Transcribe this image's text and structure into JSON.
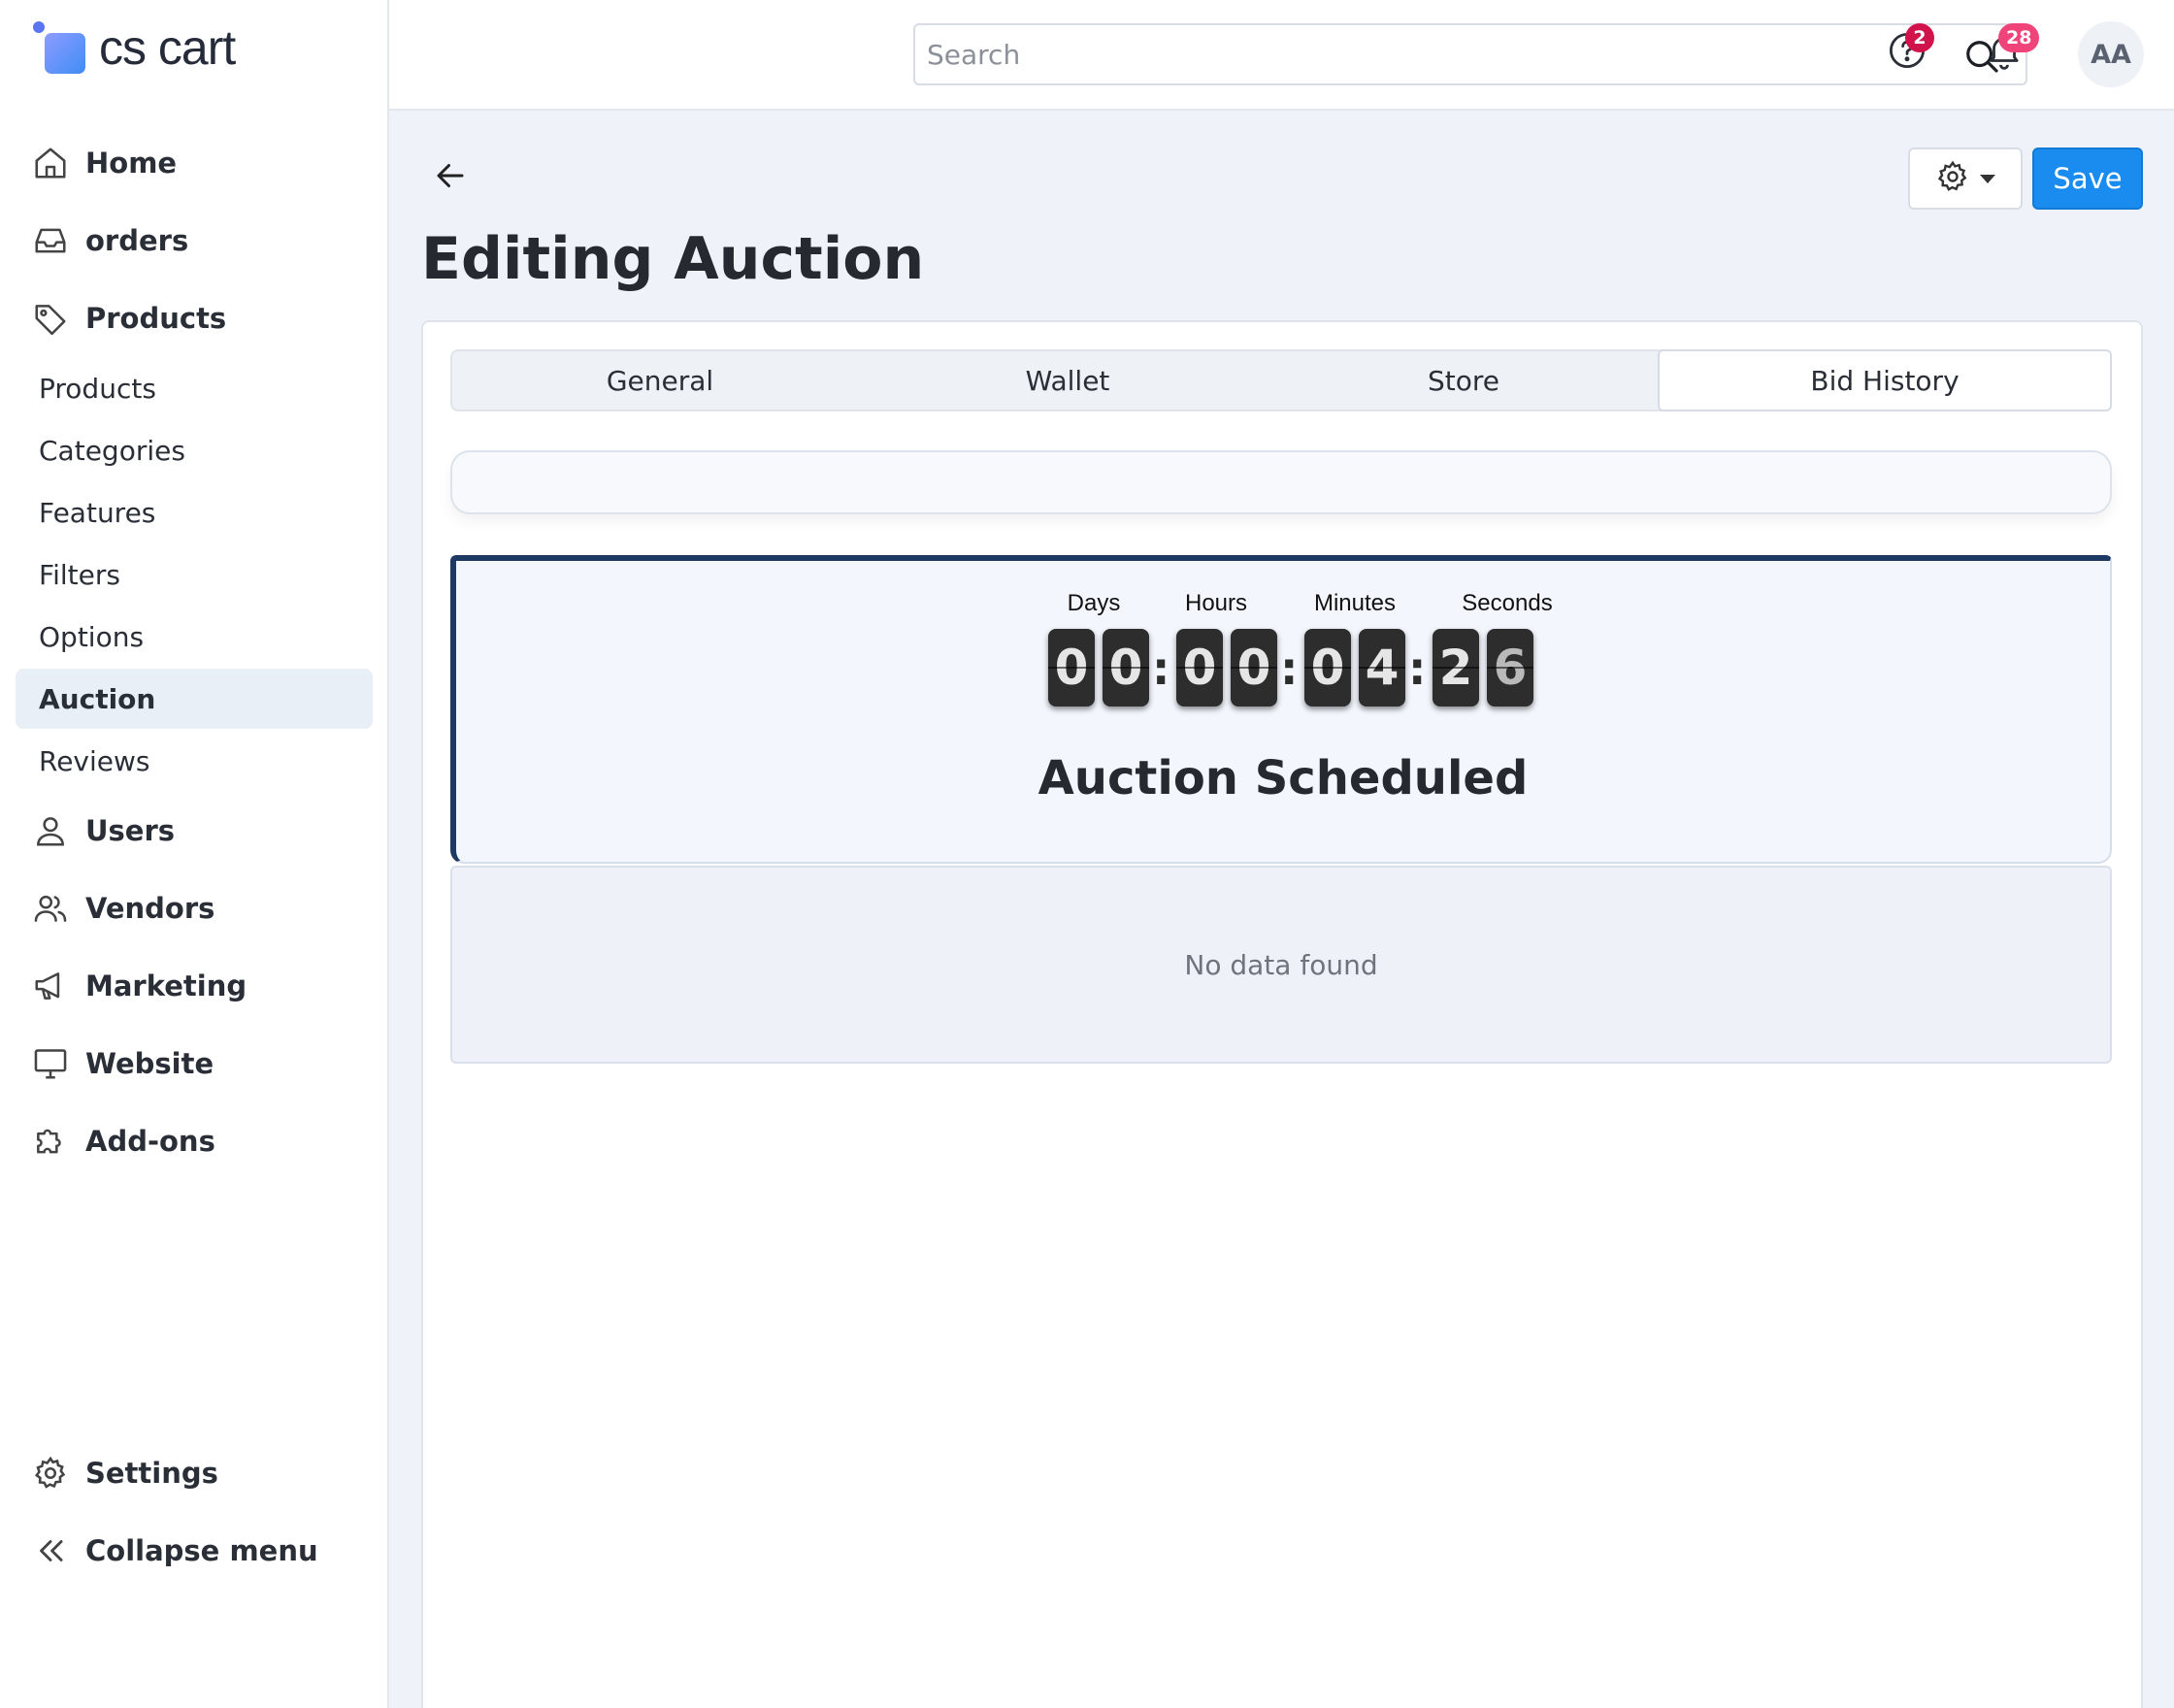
{
  "brand": {
    "name": "cs cart"
  },
  "sidebar": {
    "main_items": [
      {
        "label": "Home",
        "icon": "home-icon"
      },
      {
        "label": "orders",
        "icon": "inbox-icon"
      },
      {
        "label": "Products",
        "icon": "tag-icon"
      }
    ],
    "sub_items": [
      {
        "label": "Products"
      },
      {
        "label": "Categories"
      },
      {
        "label": "Features"
      },
      {
        "label": "Filters"
      },
      {
        "label": "Options"
      },
      {
        "label": "Auction",
        "active": true
      },
      {
        "label": "Reviews"
      }
    ],
    "lower_items": [
      {
        "label": "Users",
        "icon": "user-icon"
      },
      {
        "label": "Vendors",
        "icon": "users-icon"
      },
      {
        "label": "Marketing",
        "icon": "megaphone-icon"
      },
      {
        "label": "Website",
        "icon": "monitor-icon"
      },
      {
        "label": "Add-ons",
        "icon": "puzzle-icon"
      }
    ],
    "footer_items": [
      {
        "label": "Settings",
        "icon": "gear-icon"
      },
      {
        "label": "Collapse menu",
        "icon": "double-chevron-left-icon"
      }
    ]
  },
  "header": {
    "search_placeholder": "Search",
    "help_badge": "2",
    "notifications_badge": "28",
    "avatar_initials": "AA",
    "colors": {
      "help_badge": "#d0134b",
      "notifications_badge": "#f0437a"
    }
  },
  "page": {
    "title": "Editing Auction",
    "save_label": "Save",
    "colors": {
      "primary": "#1a8cf0",
      "panel_border": "#1e3a64"
    }
  },
  "tabs": [
    {
      "label": "General"
    },
    {
      "label": "Wallet"
    },
    {
      "label": "Store"
    },
    {
      "label": "Bid History",
      "active": true
    }
  ],
  "countdown": {
    "labels": {
      "days": "Days",
      "hours": "Hours",
      "minutes": "Minutes",
      "seconds": "Seconds"
    },
    "days": [
      "0",
      "0"
    ],
    "hours": [
      "0",
      "0"
    ],
    "minutes": [
      "0",
      "4"
    ],
    "seconds": [
      "2",
      "6"
    ],
    "separator": ":",
    "status": "Auction Scheduled"
  },
  "bid_history": {
    "empty_message": "No data found"
  }
}
